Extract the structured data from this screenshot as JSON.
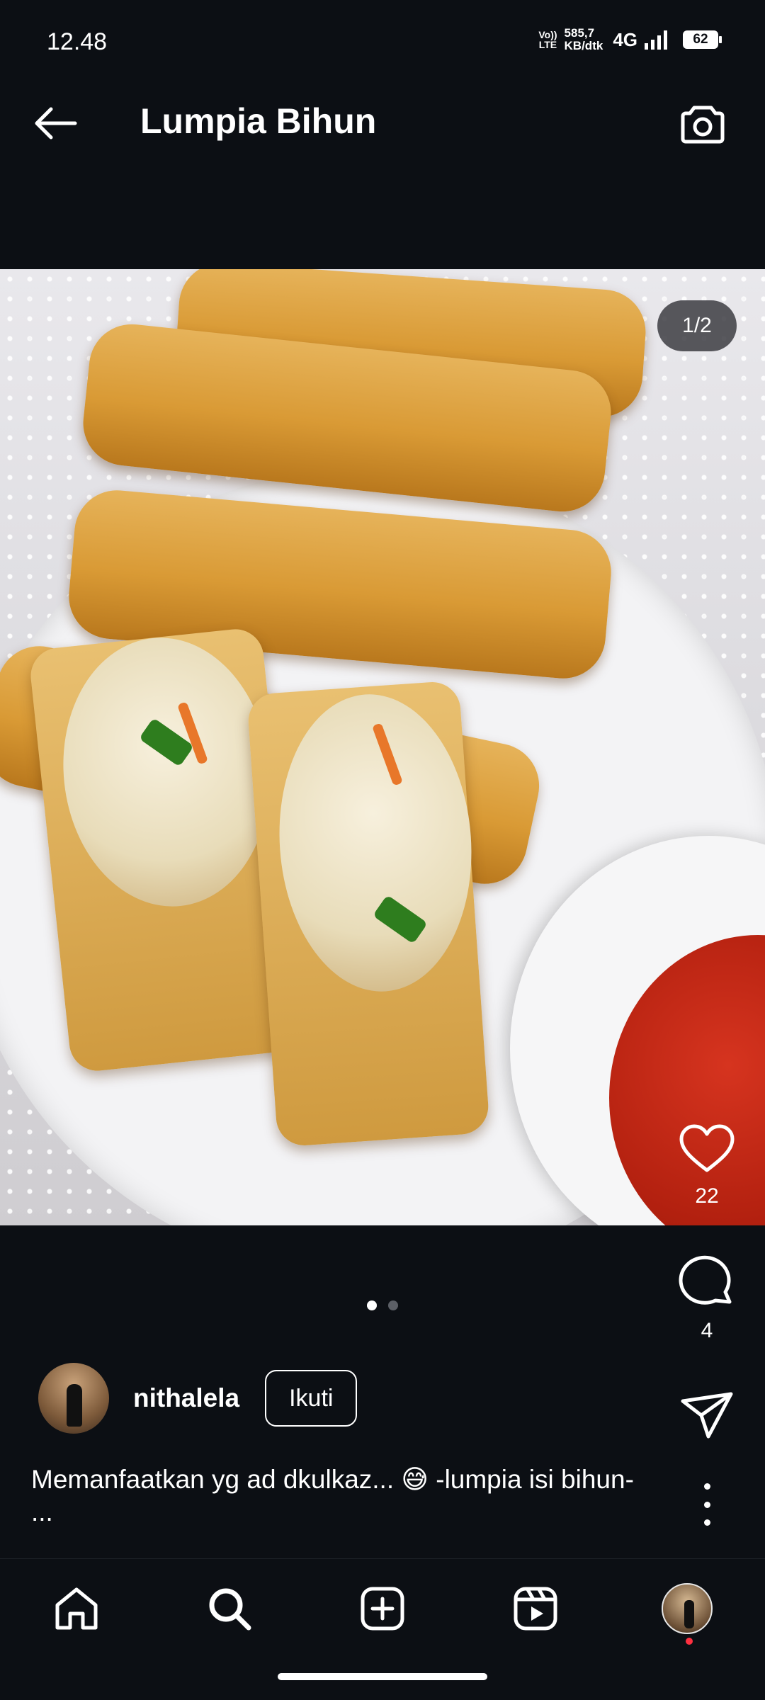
{
  "status_bar": {
    "time": "12.48",
    "volte": "Vo))",
    "lte": "LTE",
    "speed_value": "585,7",
    "speed_unit": "KB/dtk",
    "network": "4G",
    "battery": "62"
  },
  "header": {
    "title": "Lumpia Bihun",
    "back_icon": "arrow-left-icon",
    "camera_icon": "camera-icon"
  },
  "post": {
    "page_indicator": "1/2",
    "current_slide": 1,
    "total_slides": 2,
    "likes": "22",
    "comments": "4",
    "author": "nithalela",
    "follow_label": "Ikuti",
    "caption": "Memanfaatkan yg ad dkulkaz... 😅 -lumpia isi bihun- ..."
  },
  "bottom_nav": {
    "items": [
      "home-icon",
      "search-icon",
      "create-icon",
      "reels-icon",
      "profile-avatar"
    ],
    "active": "search-icon"
  },
  "colors": {
    "background": "#0c0f14",
    "text": "#ffffff",
    "notification_dot": "#ff3040"
  }
}
